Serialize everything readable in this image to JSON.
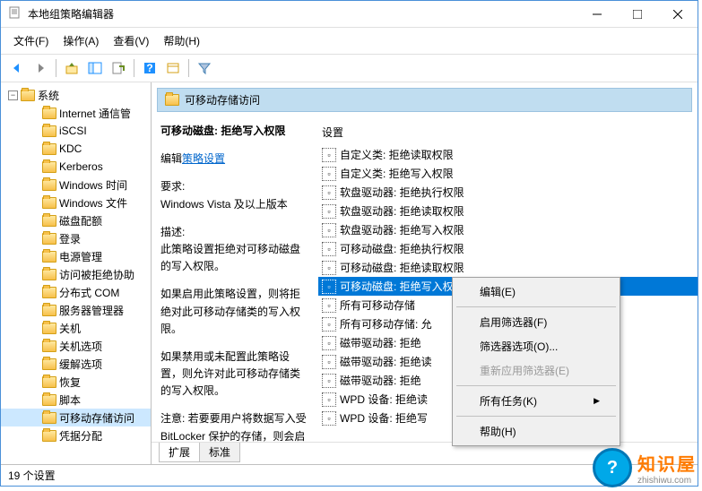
{
  "window": {
    "title": "本地组策略编辑器"
  },
  "menubar": {
    "file": "文件(F)",
    "action": "操作(A)",
    "view": "查看(V)",
    "help": "帮助(H)"
  },
  "tree": {
    "root": "系统",
    "items": [
      "Internet 通信管",
      "iSCSI",
      "KDC",
      "Kerberos",
      "Windows 时间",
      "Windows 文件",
      "磁盘配额",
      "登录",
      "电源管理",
      "访问被拒绝协助",
      "分布式 COM",
      "服务器管理器",
      "关机",
      "关机选项",
      "缓解选项",
      "恢复",
      "脚本",
      "可移动存储访问",
      "凭据分配"
    ],
    "selected_index": 17
  },
  "right_header": "可移动存储访问",
  "description": {
    "title": "可移动磁盘: 拒绝写入权限",
    "edit_prefix": "编辑",
    "edit_link": "策略设置",
    "req_label": "要求:",
    "req_value": "Windows Vista 及以上版本",
    "desc_label": "描述:",
    "desc_body": "此策略设置拒绝对可移动磁盘的写入权限。",
    "para2": "如果启用此策略设置，则将拒绝对此可移动存储类的写入权限。",
    "para3": "如果禁用或未配置此策略设置，则允许对此可移动存储类的写入权限。",
    "para4": "注意: 若要要用户将数据写入受 BitLocker 保护的存储，则会启用\"拒绝对不受 BitLocker 保护的驱"
  },
  "settings": {
    "header": "设置",
    "items": [
      "自定义类: 拒绝读取权限",
      "自定义类: 拒绝写入权限",
      "软盘驱动器: 拒绝执行权限",
      "软盘驱动器: 拒绝读取权限",
      "软盘驱动器: 拒绝写入权限",
      "可移动磁盘: 拒绝执行权限",
      "可移动磁盘: 拒绝读取权限",
      "可移动磁盘: 拒绝写入权限",
      "所有可移动存储",
      "所有可移动存储: 允",
      "磁带驱动器: 拒绝",
      "磁带驱动器: 拒绝读",
      "磁带驱动器: 拒绝",
      "WPD 设备: 拒绝读",
      "WPD 设备: 拒绝写"
    ],
    "selected_index": 7
  },
  "context_menu": {
    "edit": "编辑(E)",
    "enable_filter": "启用筛选器(F)",
    "filter_options": "筛选器选项(O)...",
    "reapply_filter": "重新应用筛选器(E)",
    "all_tasks": "所有任务(K)",
    "help": "帮助(H)"
  },
  "tabs": {
    "extended": "扩展",
    "standard": "标准"
  },
  "status": "19 个设置",
  "watermark": {
    "brand": "知识屋",
    "domain": "zhishiwu.com",
    "badge": "?"
  }
}
